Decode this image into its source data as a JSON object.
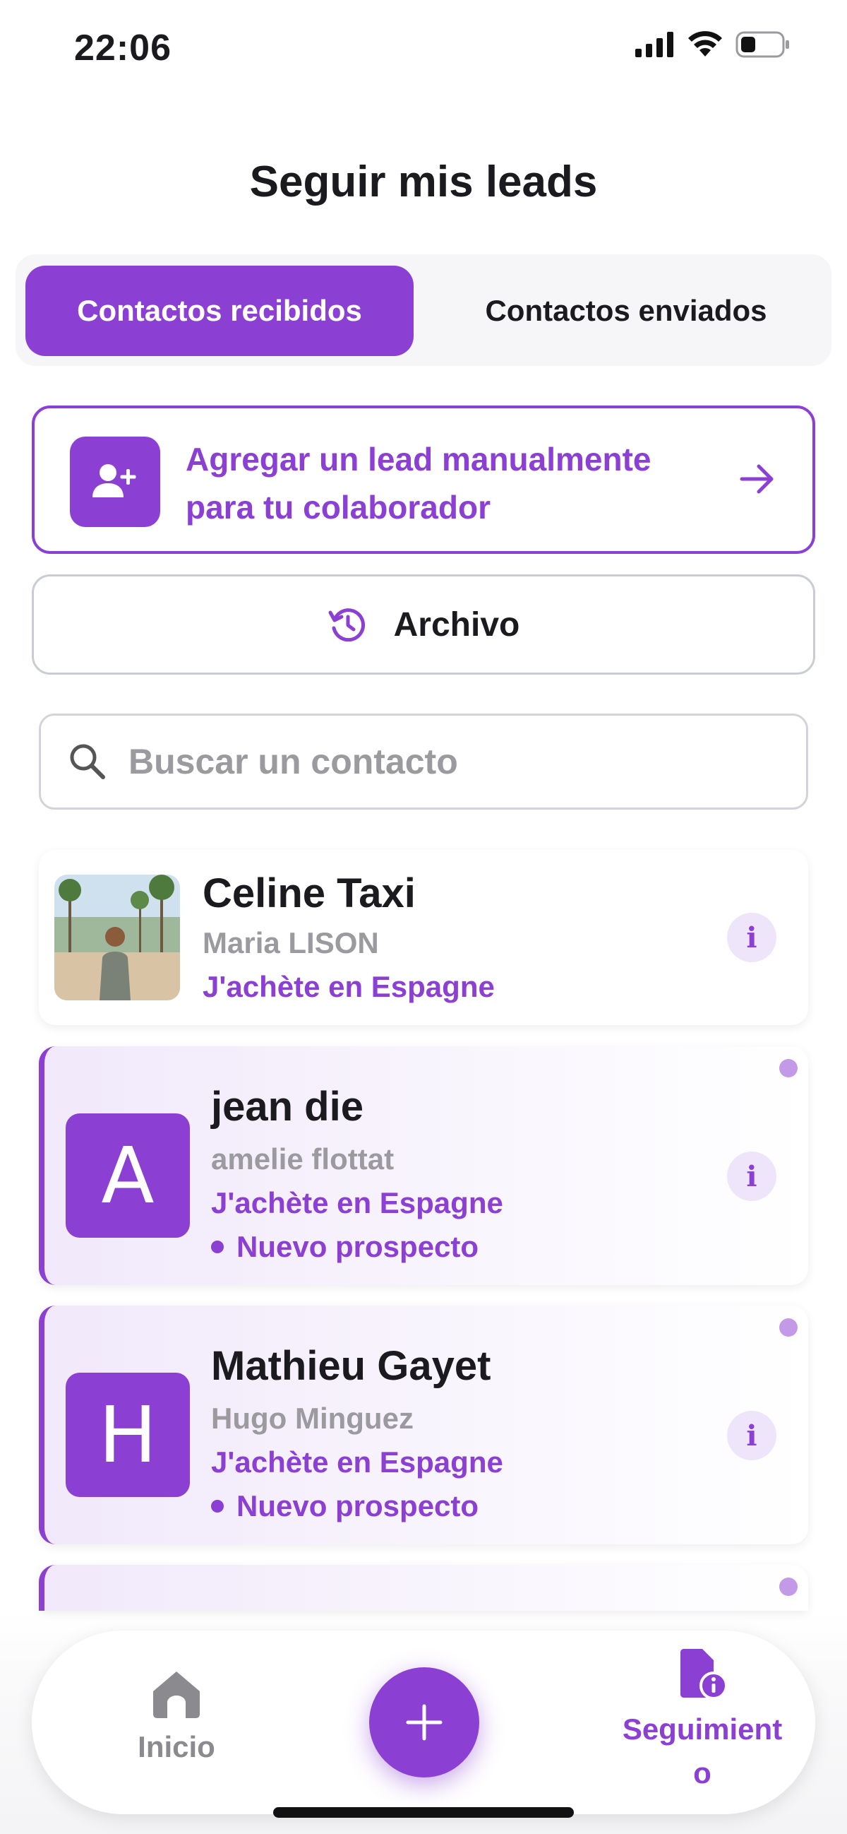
{
  "status_bar": {
    "time": "22:06",
    "icons": [
      "signal-icon",
      "wifi-icon",
      "battery-icon"
    ]
  },
  "page": {
    "title": "Seguir mis leads"
  },
  "tabs": [
    {
      "label": "Contactos recibidos",
      "active": true
    },
    {
      "label": "Contactos enviados",
      "active": false
    }
  ],
  "add_lead": {
    "line1": "Agregar un lead manualmente",
    "line2": "para tu colaborador",
    "icon": "add-user-icon"
  },
  "archive": {
    "label": "Archivo",
    "icon": "history-icon"
  },
  "search": {
    "placeholder": "Buscar un contacto",
    "value": ""
  },
  "leads": [
    {
      "name": "Celine Taxi",
      "partner": "Maria LISON",
      "tag": "J'achète en Espagne",
      "status": "",
      "avatar": "photo",
      "highlighted": false
    },
    {
      "name": "jean die",
      "partner": "amelie flottat",
      "tag": "J'achète en Espagne",
      "status": "Nuevo prospecto",
      "avatar_letter": "A",
      "highlighted": true
    },
    {
      "name": "Mathieu Gayet",
      "partner": "Hugo Minguez",
      "tag": "J'achète en Espagne",
      "status": "Nuevo prospecto",
      "avatar_letter": "H",
      "highlighted": true
    }
  ],
  "info_glyph": "i",
  "nav": {
    "home_label": "Inicio",
    "add_label": "+",
    "follow_line1": "Seguimient",
    "follow_line2": "o"
  },
  "colors": {
    "accent": "#8b3fd3",
    "accent_light": "#efe5fa",
    "muted": "#9a9a9f",
    "border": "#c9ccd3"
  }
}
